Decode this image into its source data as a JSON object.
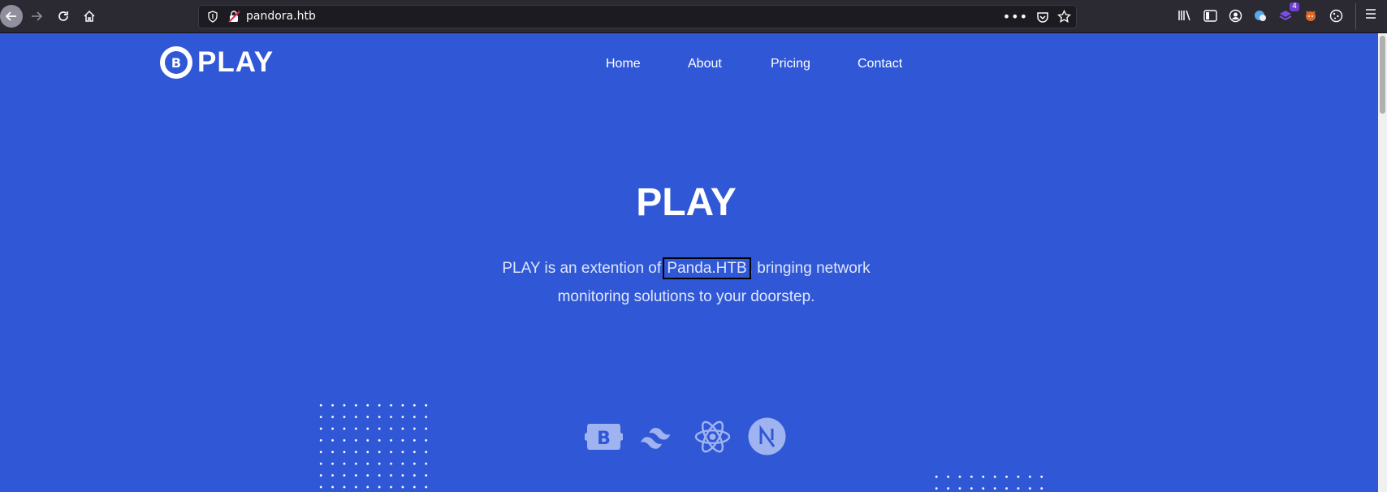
{
  "browser": {
    "url": "pandora.htb",
    "library_badge_count": "4"
  },
  "site": {
    "logo_letter": "B",
    "logo_text": "PLAY",
    "nav": {
      "home": "Home",
      "about": "About",
      "pricing": "Pricing",
      "contact": "Contact"
    },
    "hero": {
      "title": "PLAY",
      "desc_before": "PLAY is an extention of ",
      "desc_highlight": "Panda.HTB",
      "desc_after": ", bringing network monitoring solutions to your doorstep."
    }
  },
  "tech_icons": [
    "bootstrap-icon",
    "tailwind-icon",
    "react-icon",
    "nextjs-icon"
  ],
  "colors": {
    "page_bg": "#3058d6",
    "chrome_bg": "#2b2a33",
    "urlbar_bg": "#1c1b22",
    "icon_tint": "#9fb3f0"
  }
}
